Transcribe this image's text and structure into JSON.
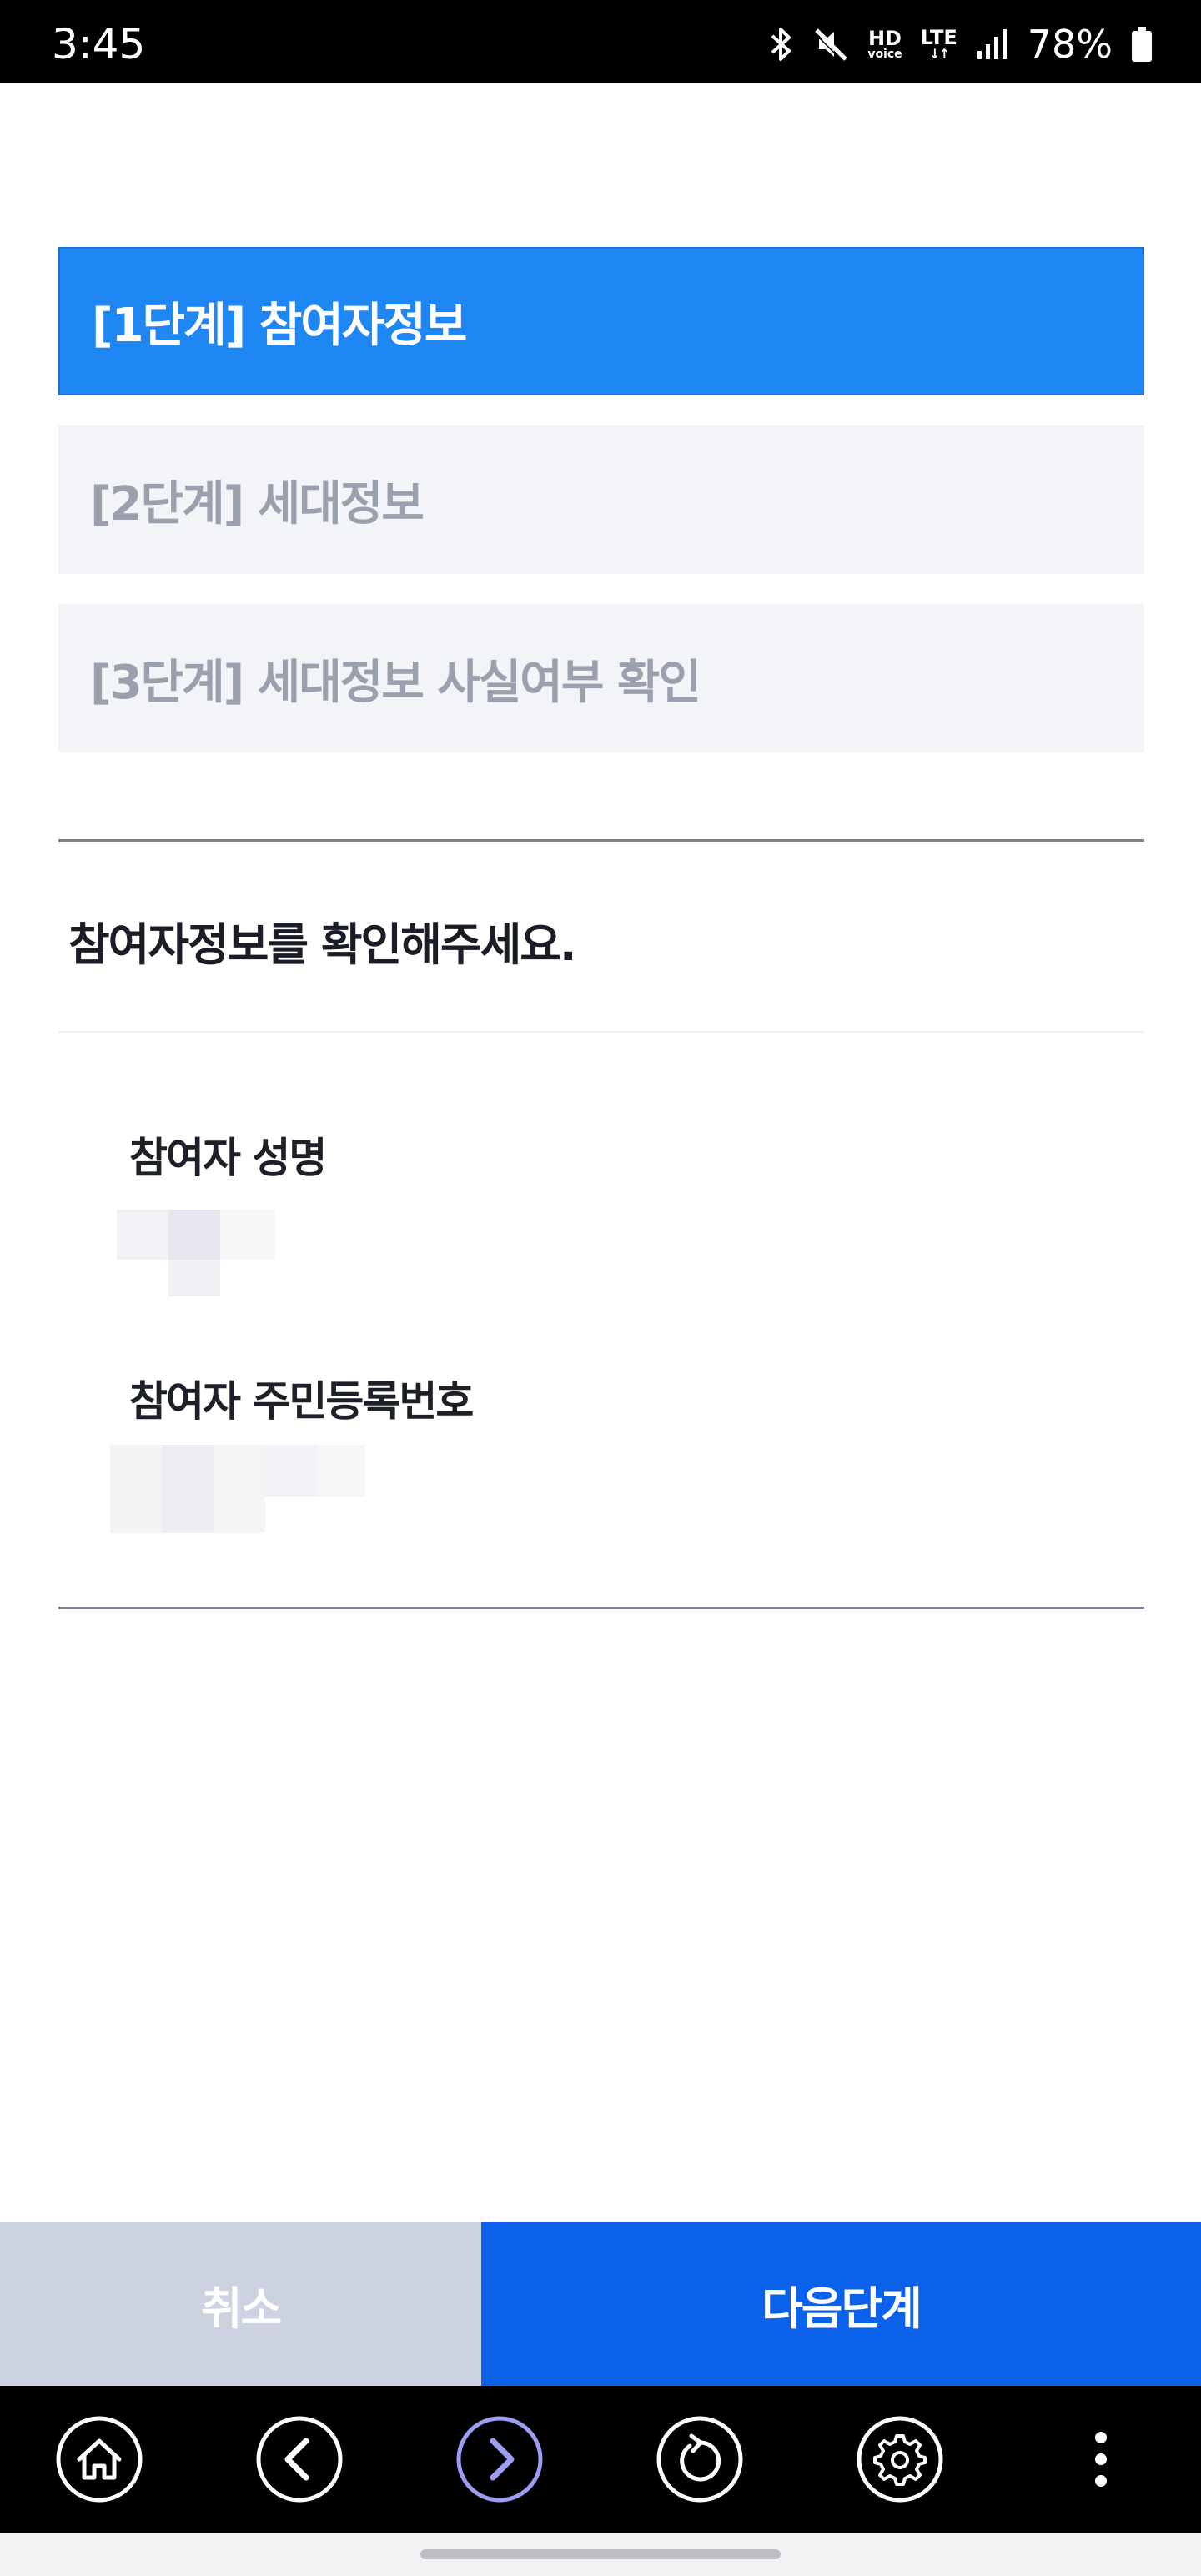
{
  "status_bar": {
    "time": "3:45",
    "hd_big": "HD",
    "hd_small": "voice",
    "lte_big": "LTE",
    "lte_small": "↓↑",
    "battery": "78%",
    "icons": [
      "bluetooth-icon",
      "mute-icon",
      "hd-voice-icon",
      "lte-icon",
      "signal-icon",
      "battery-icon"
    ]
  },
  "steps": [
    {
      "label": "[1단계] 참여자정보",
      "active": true
    },
    {
      "label": "[2단계] 세대정보",
      "active": false
    },
    {
      "label": "[3단계] 세대정보 사실여부 확인",
      "active": false
    }
  ],
  "section_title": "참여자정보를 확인해주세요.",
  "fields": [
    {
      "label": "참여자 성명",
      "value_redacted": true
    },
    {
      "label": "참여자 주민등록번호",
      "value_redacted": true
    }
  ],
  "buttons": {
    "cancel": "취소",
    "next": "다음단계"
  },
  "nav_bar": {
    "icons": [
      "home-icon",
      "back-icon",
      "forward-icon",
      "refresh-icon",
      "settings-icon",
      "more-icon"
    ]
  },
  "colors": {
    "active_step": "#1f87f3",
    "inactive_step": "#f3f4f8",
    "cancel_button": "#cdd2e0",
    "next_button": "#0c61ea",
    "forward_icon": "#9b9cf2"
  }
}
